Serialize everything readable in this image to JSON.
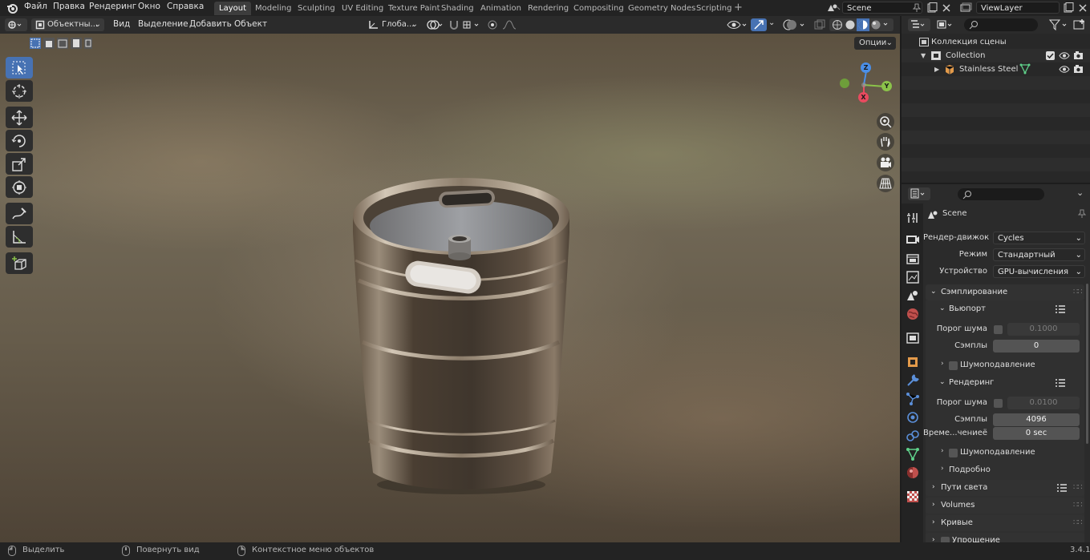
{
  "menu": {
    "items": [
      "Файл",
      "Правка",
      "Рендеринг",
      "Окно",
      "Справка"
    ]
  },
  "workspaces": {
    "tabs": [
      "Layout",
      "Modeling",
      "Sculpting",
      "UV Editing",
      "Texture Paint",
      "Shading",
      "Animation",
      "Rendering",
      "Compositing",
      "Geometry Nodes",
      "Scripting"
    ],
    "active": "Layout",
    "add_icon": "plus-icon"
  },
  "scene": {
    "name": "Scene"
  },
  "view_layer": {
    "name": "ViewLayer"
  },
  "viewport_header": {
    "mode": "Объектны...",
    "menus": [
      "Вид",
      "Выделение",
      "Добавить",
      "Объект"
    ],
    "transform_orientation": "Глоба...",
    "options_label": "Опции"
  },
  "gizmo": {
    "x": "X",
    "y": "Y",
    "z": "Z"
  },
  "outliner": {
    "scene_collection": "Коллекция сцены",
    "collection": "Collection",
    "object": "Stainless Steel"
  },
  "properties": {
    "context": "Scene",
    "render_engine": {
      "label": "Рендер-движок",
      "value": "Cycles"
    },
    "mode": {
      "label": "Режим",
      "value": "Стандартный"
    },
    "device": {
      "label": "Устройство",
      "value": "GPU-вычисления"
    },
    "sampling": {
      "title": "Сэмплирование",
      "viewport": {
        "title": "Вьюпорт",
        "noise_threshold_label": "Порог шума",
        "noise_threshold": "0.1000",
        "samples_label": "Сэмплы",
        "samples": "0",
        "denoise_label": "Шумоподавление"
      },
      "render": {
        "title": "Рендеринг",
        "noise_threshold_label": "Порог шума",
        "noise_threshold": "0.0100",
        "samples_label": "Сэмплы",
        "samples": "4096",
        "time_limit_label": "Време...чениеё",
        "time_limit": "0 sec",
        "denoise_label": "Шумоподавление"
      },
      "advanced_label": "Подробно"
    },
    "panels": [
      "Пути света",
      "Volumes",
      "Кривые",
      "Упрощение"
    ]
  },
  "status_bar": {
    "select": "Выделить",
    "rotate": "Повернуть вид",
    "context_menu": "Контекстное меню объектов",
    "version": "3.4.1"
  },
  "colors": {
    "accent": "#4772b3",
    "x_axis": "#e84a5f",
    "y_axis": "#8bc34a",
    "z_axis": "#4a8fe8"
  }
}
